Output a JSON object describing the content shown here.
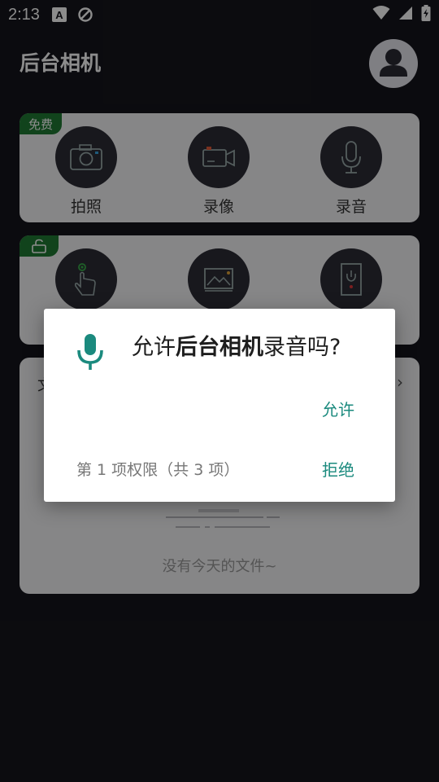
{
  "status_bar": {
    "time": "2:13"
  },
  "app": {
    "title": "后台相机"
  },
  "free_card": {
    "tag": "免费",
    "features": [
      {
        "label": "拍照",
        "icon": "camera-icon"
      },
      {
        "label": "录像",
        "icon": "video-camera-icon"
      },
      {
        "label": "录音",
        "icon": "microphone-icon"
      }
    ]
  },
  "locked_card": {
    "features": [
      {
        "icon": "touch-icon"
      },
      {
        "icon": "image-icon"
      },
      {
        "icon": "power-icon"
      }
    ]
  },
  "files_card": {
    "title": "文",
    "empty_text": "没有今天的文件~"
  },
  "dialog": {
    "title_prefix": "允许",
    "title_app": "后台相机",
    "title_suffix": "录音吗?",
    "allow_label": "允许",
    "counter": "第 1 项权限（共 3 项）",
    "deny_label": "拒绝",
    "accent_color": "#1b8a7e"
  }
}
